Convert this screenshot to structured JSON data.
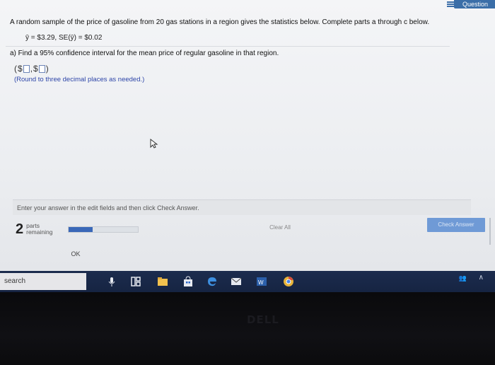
{
  "header": {
    "corner_label": "Question"
  },
  "question": {
    "text": "A random sample of the price of gasoline from 20 gas stations in a region gives the statistics below. Complete parts a through c below.",
    "stats": "ȳ = $3.29, SE(ȳ) = $0.02",
    "part_a": "a) Find a 95% confidence interval for the mean price of regular gasoline in that region.",
    "interval_open": "(",
    "currency_1": "$",
    "separator": ",",
    "currency_2": "$",
    "interval_close": ")",
    "round_note": "(Round to three decimal places as needed.)"
  },
  "footer": {
    "instruction": "Enter your answer in the edit fields and then click Check Answer.",
    "parts_count": "2",
    "parts_label_1": "parts",
    "parts_label_2": "remaining",
    "progress": 0.35,
    "clear_all": "Clear All",
    "check_answer": "Check Answer",
    "ok": "OK"
  },
  "taskbar": {
    "search_placeholder": "search",
    "icons": [
      "microphone-icon",
      "task-view-icon",
      "file-explorer-icon",
      "store-icon",
      "edge-icon",
      "mail-icon",
      "word-icon",
      "chrome-icon"
    ],
    "tray": [
      "people-icon",
      "chevron-up-icon"
    ]
  },
  "bezel": {
    "brand": "DELL"
  }
}
